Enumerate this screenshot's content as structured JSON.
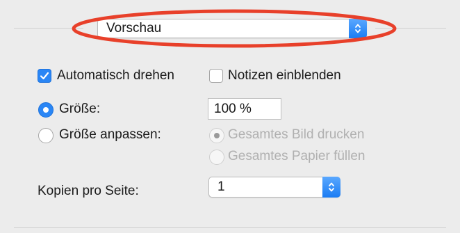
{
  "header": {
    "popup_value": "Vorschau"
  },
  "options": {
    "auto_rotate_label": "Automatisch drehen",
    "auto_rotate_checked": true,
    "show_notes_label": "Notizen einblenden",
    "show_notes_checked": false,
    "size_label": "Größe:",
    "size_value": "100 %",
    "fit_label": "Größe anpassen:",
    "fit_selected": "size",
    "print_entire_image_label": "Gesamtes Bild drucken",
    "fill_entire_paper_label": "Gesamtes Papier füllen",
    "copies_per_page_label": "Kopien pro Seite:",
    "copies_per_page_value": "1"
  },
  "colors": {
    "accent": "#2a86f5",
    "highlight": "#e8402a",
    "background": "#ececec"
  }
}
